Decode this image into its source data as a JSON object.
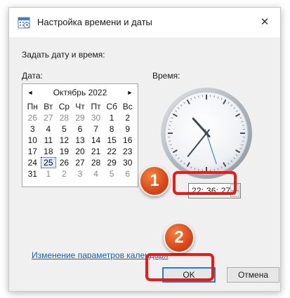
{
  "window": {
    "title": "Настройка времени и даты",
    "close_icon": "close-icon",
    "app_icon": "calendar-clock-icon"
  },
  "subheading": "Задать дату и время:",
  "date_label": "Дата:",
  "time_label": "Время:",
  "calendar": {
    "month_title": "Октябрь 2022",
    "prev_icon": "◄",
    "next_icon": "►",
    "weekdays": [
      "Пн",
      "Вт",
      "Ср",
      "Чт",
      "Пт",
      "Сб",
      "Вс"
    ],
    "weeks": [
      [
        "26",
        "27",
        "28",
        "29",
        "30",
        "1",
        "2"
      ],
      [
        "3",
        "4",
        "5",
        "6",
        "7",
        "8",
        "9"
      ],
      [
        "10",
        "11",
        "12",
        "13",
        "14",
        "15",
        "16"
      ],
      [
        "17",
        "18",
        "19",
        "20",
        "21",
        "22",
        "23"
      ],
      [
        "24",
        "25",
        "26",
        "27",
        "28",
        "29",
        "30"
      ],
      [
        "31",
        "1",
        "2",
        "3",
        "4",
        "5",
        "6"
      ]
    ],
    "selected_day": "25"
  },
  "clock": {
    "hour": 22,
    "minute": 36,
    "second": 27
  },
  "time_field": {
    "value": "22: 36: 27",
    "spin_up": "▲",
    "spin_down": "▼"
  },
  "badges": {
    "one": "1",
    "two": "2"
  },
  "calendar_link": "Изменение параметров календаря",
  "buttons": {
    "ok": "OK",
    "cancel": "Отмена"
  },
  "colors": {
    "highlight_red": "#e81b1b",
    "badge_orange": "#d8471a",
    "link_blue": "#1a5fb4",
    "focus_blue": "#2a7ad6"
  }
}
